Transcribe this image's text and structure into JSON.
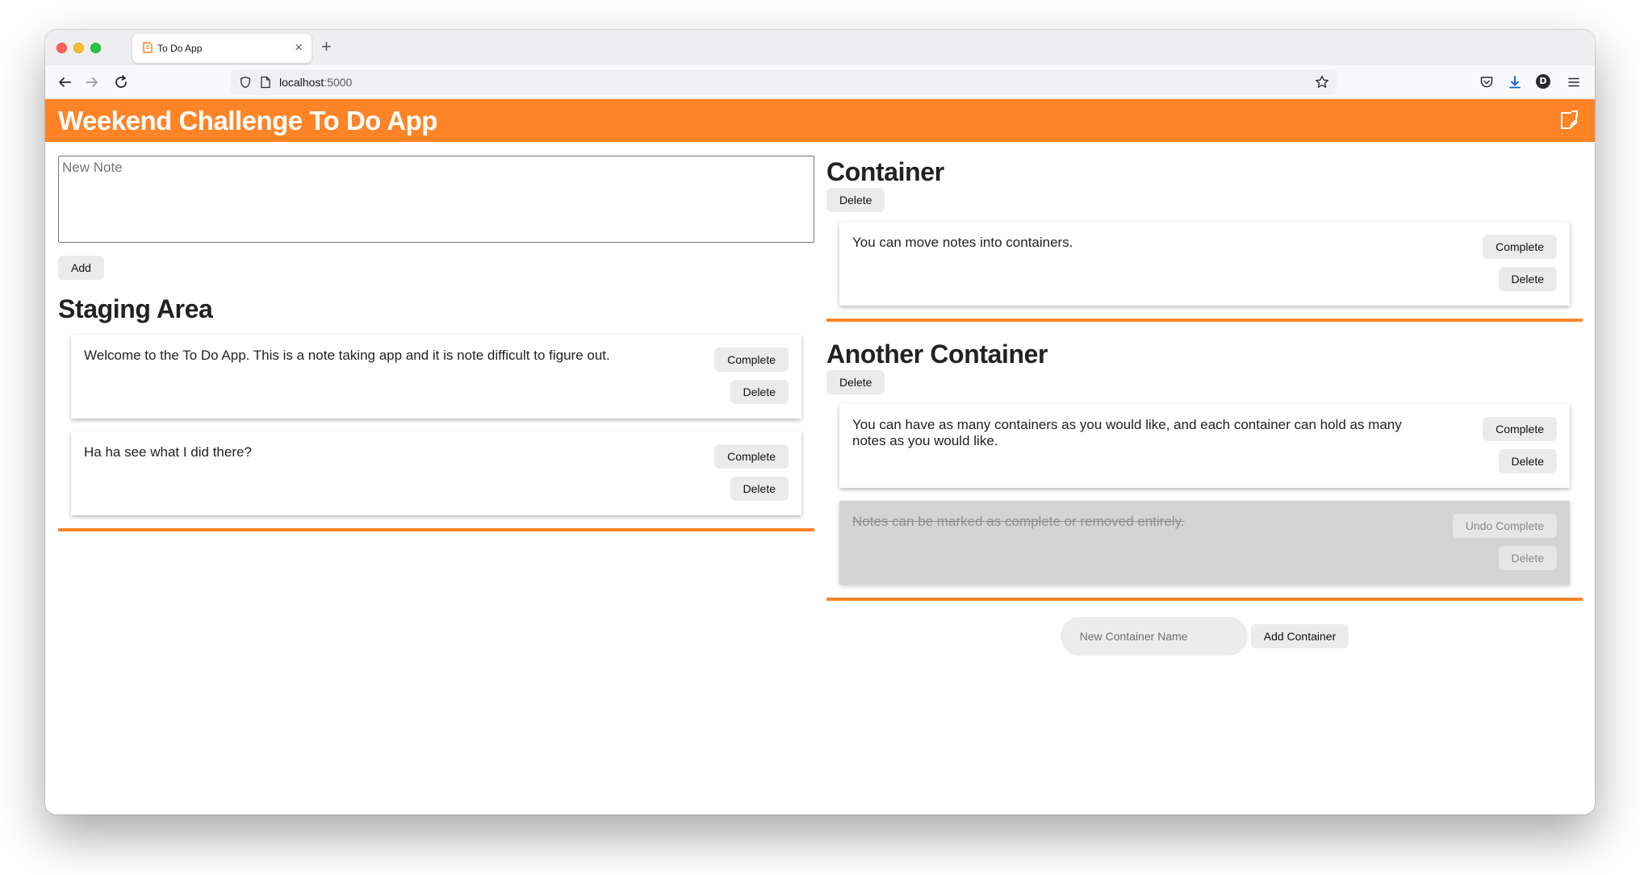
{
  "browser": {
    "tab_title": "To Do App",
    "url_host": "localhost",
    "url_port": ":5000",
    "account_initial": "D"
  },
  "app": {
    "title": "Weekend Challenge To Do App",
    "accent_color": "#fe8427"
  },
  "new_note": {
    "placeholder": "New Note",
    "add_label": "Add"
  },
  "staging": {
    "title": "Staging Area",
    "notes": [
      {
        "text": "Welcome to the To Do App. This is a note taking app and it is note difficult to figure out.",
        "complete_label": "Complete",
        "delete_label": "Delete"
      },
      {
        "text": "Ha ha see what I did there?",
        "complete_label": "Complete",
        "delete_label": "Delete"
      }
    ]
  },
  "containers": [
    {
      "title": "Container",
      "delete_label": "Delete",
      "notes": [
        {
          "text": "You can move notes into containers.",
          "complete_label": "Complete",
          "delete_label": "Delete"
        }
      ]
    },
    {
      "title": "Another Container",
      "delete_label": "Delete",
      "notes": [
        {
          "text": "You can have as many containers as you would like, and each container can hold as many notes as you would like.",
          "complete_label": "Complete",
          "delete_label": "Delete"
        },
        {
          "text": "Notes can be marked as complete or removed entirely.",
          "undo_label": "Undo Complete",
          "delete_label": "Delete",
          "completed": true
        }
      ]
    }
  ],
  "add_container": {
    "placeholder": "New Container Name",
    "button_label": "Add Container"
  }
}
